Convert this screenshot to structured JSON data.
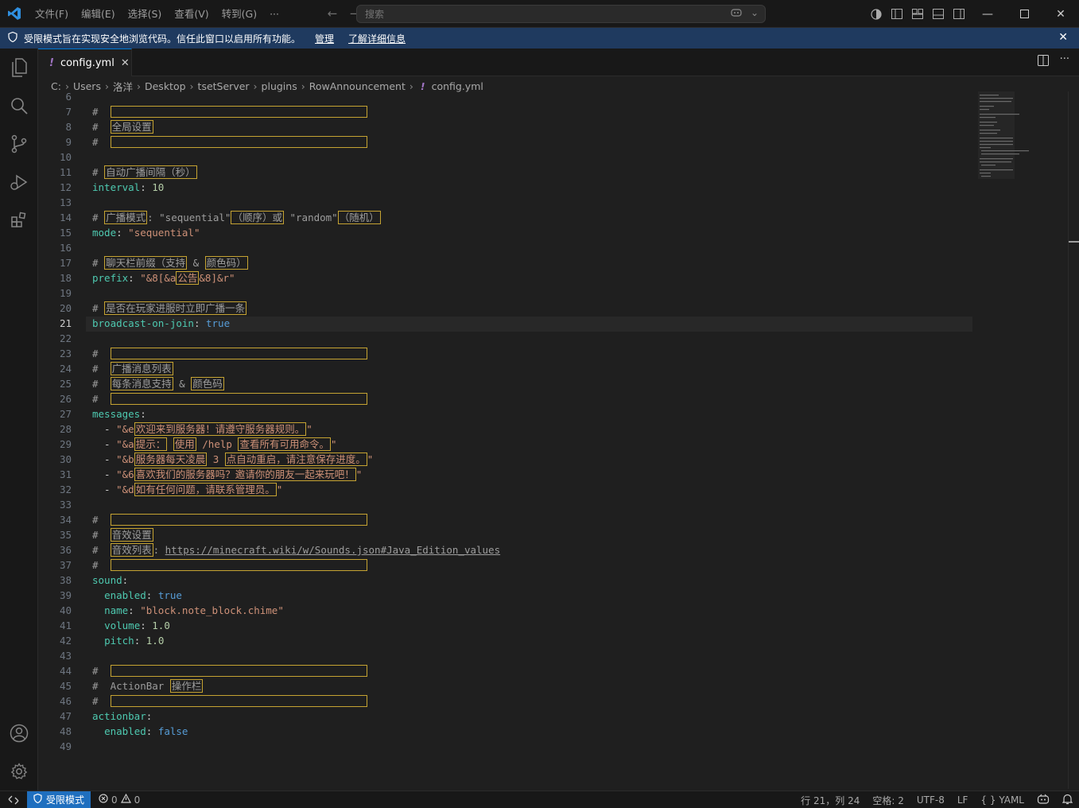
{
  "titlebar": {
    "menu": [
      "文件(F)",
      "编辑(E)",
      "选择(S)",
      "查看(V)",
      "转到(G)",
      "···"
    ],
    "search_placeholder": "搜索"
  },
  "banner": {
    "message": "受限模式旨在实现安全地浏览代码。信任此窗口以启用所有功能。",
    "manage": "管理",
    "learn_more": "了解详细信息"
  },
  "tab": {
    "icon": "!",
    "filename": "config.yml"
  },
  "breadcrumb": [
    "C:",
    "Users",
    "洛洋",
    "Desktop",
    "tsetServer",
    "plugins",
    "RowAnnouncement"
  ],
  "breadcrumb_file": "config.yml",
  "editor": {
    "first_line": 6,
    "last_line": 49,
    "active_line": 21,
    "lines": {
      "8": "全局设置",
      "11": "自动广播间隔（秒）",
      "12": {
        "key": "interval",
        "value": "10"
      },
      "14a": "广播模式",
      "14b": "\"sequential\"",
      "14c": "（顺序）或",
      "14d": "\"random\"",
      "14e": "（随机）",
      "15": {
        "key": "mode",
        "value": "\"sequential\""
      },
      "17a": "聊天栏前缀（支持",
      "17b": "&",
      "17c": "颜色码）",
      "18a": "\"&8[&a",
      "18b": "公告",
      "18c": "&8]&r\"",
      "20": "是否在玩家进服时立即广播一条",
      "21": {
        "key": "broadcast-on-join",
        "value": "true"
      },
      "24": "广播消息列表",
      "25a": "每条消息支持",
      "25b": "&",
      "25c": "颜色码",
      "27": "messages",
      "28": {
        "prefix": "\"&e",
        "text": "欢迎来到服务器！请遵守服务器规则。"
      },
      "29": {
        "prefix": "\"&a",
        "t1": "提示：",
        "t2": "使用",
        "mid": " /help ",
        "t3": "查看所有可用命令。"
      },
      "30": {
        "prefix": "\"&b",
        "t1": "服务器每天凌晨",
        "mid": " 3 ",
        "t2": "点自动重启，请注意保存进度。"
      },
      "31": {
        "prefix": "\"&6",
        "text": "喜欢我们的服务器吗？邀请你的朋友一起来玩吧！"
      },
      "32": {
        "prefix": "\"&d",
        "text": "如有任何问题，请联系管理员。"
      },
      "35": "音效设置",
      "36a": "音效列表",
      "36b": "https://minecraft.wiki/w/Sounds.json#Java_Edition_values",
      "38": "sound",
      "39": {
        "key": "enabled",
        "value": "true"
      },
      "40": {
        "key": "name",
        "value": "\"block.note_block.chime\""
      },
      "41": {
        "key": "volume",
        "value": "1.0"
      },
      "42": {
        "key": "pitch",
        "value": "1.0"
      },
      "45a": "ActionBar",
      "45b": "操作栏",
      "47": "actionbar",
      "48": {
        "key": "enabled",
        "value": "false"
      }
    }
  },
  "statusbar": {
    "restricted": "受限模式",
    "errors": "0",
    "warnings": "0",
    "position": "行 21，列 24",
    "spaces": "空格: 2",
    "encoding": "UTF-8",
    "eol": "LF",
    "language": "YAML",
    "language_icon": "{ }"
  },
  "colors": {
    "accent": "#0078d4",
    "banner": "#1f3a5f",
    "restricted": "#1f6fbf",
    "unicode_highlight": "#c5a332"
  }
}
